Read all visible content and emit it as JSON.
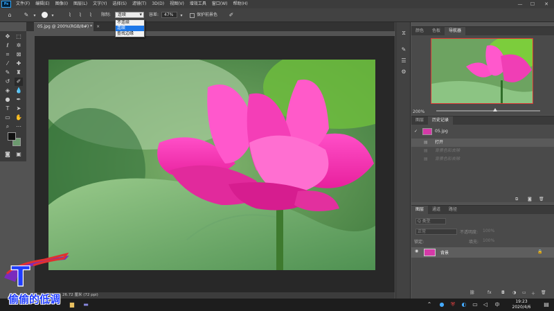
{
  "menubar": {
    "logo": "Ps",
    "items": [
      "文件(F)",
      "编辑(E)",
      "图像(I)",
      "图层(L)",
      "文字(Y)",
      "选择(S)",
      "滤镜(T)",
      "3D(D)",
      "视图(V)",
      "增效工具",
      "窗口(W)",
      "帮助(H)"
    ],
    "minimize": "—",
    "maximize": "☐",
    "close": "✕"
  },
  "options": {
    "limits_label": "限制:",
    "limits_value": "连续",
    "tolerance_label": "容差:",
    "tolerance_value": "47%",
    "protect_fg_label": "保护前景色"
  },
  "dropdown": {
    "options": [
      "不连续",
      "连续",
      "查找边缘"
    ],
    "selected_index": 1
  },
  "document": {
    "tab_title": "05.jpg @ 200%(RGB/8#) *",
    "tab_close": "×",
    "status_text": "26.72 厘米 (72 ppi)"
  },
  "colors": {
    "foreground": "#111111",
    "background": "#6c9a6f",
    "accent": "#1e78e8"
  },
  "navigator": {
    "tabs": [
      "颜色",
      "色板",
      "导航器"
    ],
    "active_tab": "导航器",
    "zoom": "200%"
  },
  "history": {
    "tabs": [
      "图层",
      "历史记录"
    ],
    "active_tab": "历史记录",
    "snapshot": "05.jpg",
    "items": [
      "打开",
      "背景色彩去除",
      "背景色彩去除"
    ]
  },
  "layers": {
    "tabs": [
      "图层",
      "通道",
      "路径"
    ],
    "active_tab": "图层",
    "search_placeholder": "Q 类型",
    "blend_mode": "正常",
    "opacity_label": "不透明度:",
    "opacity_value": "100%",
    "lock_label": "锁定:",
    "fill_label": "填充:",
    "fill_value": "100%",
    "items": [
      {
        "name": "背景",
        "visible": true,
        "locked": true
      }
    ]
  },
  "taskbar": {
    "time": "19:23",
    "date": "2020/4/6",
    "lang": "中"
  },
  "watermark": {
    "text": "偷偷的低调"
  }
}
